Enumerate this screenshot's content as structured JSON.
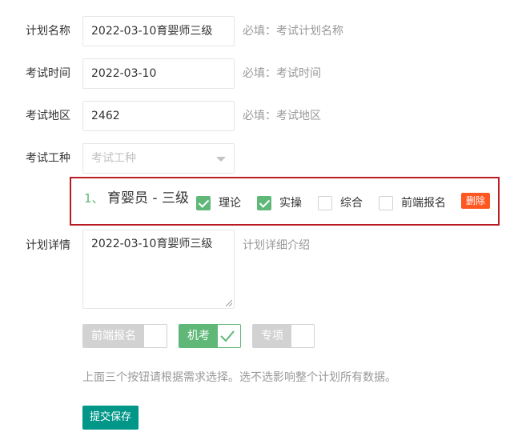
{
  "form": {
    "plan_name": {
      "label": "计划名称",
      "value": "2022-03-10育婴师三级",
      "hint": "必填：考试计划名称"
    },
    "exam_time": {
      "label": "考试时间",
      "value": "2022-03-10",
      "hint": "必填：考试时间"
    },
    "exam_region": {
      "label": "考试地区",
      "value": "2462",
      "hint": "必填：考试地区"
    },
    "exam_type": {
      "label": "考试工种",
      "placeholder": "考试工种",
      "icon": "chevron-down-icon"
    },
    "type_item": {
      "index": "1、",
      "name": "育婴员 - 三级",
      "options": [
        {
          "label": "理论",
          "checked": true
        },
        {
          "label": "实操",
          "checked": true
        },
        {
          "label": "综合",
          "checked": false
        },
        {
          "label": "前端报名",
          "checked": false
        }
      ],
      "delete_label": "删除"
    },
    "plan_detail": {
      "label": "计划详情",
      "value": "2022-03-10育婴师三级",
      "hint": "计划详细介绍"
    },
    "switches": [
      {
        "label": "前端报名",
        "on": false
      },
      {
        "label": "机考",
        "on": true
      },
      {
        "label": "专项",
        "on": false
      }
    ],
    "note": "上面三个按钮请根据需求选择。选不选影响整个计划所有数据。",
    "submit_label": "提交保存"
  },
  "colors": {
    "accent": "#5fb878",
    "danger": "#ff5722",
    "primary": "#009688",
    "highlight_border": "#b81c22"
  }
}
